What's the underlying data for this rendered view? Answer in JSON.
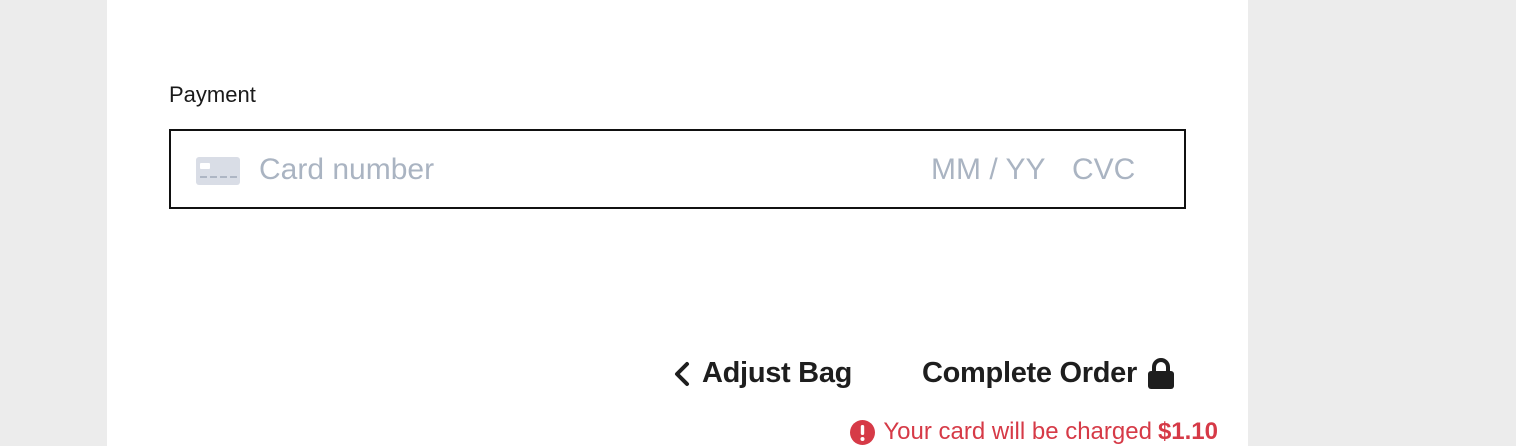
{
  "payment": {
    "label": "Payment",
    "card_number_placeholder": "Card number",
    "expiry_placeholder": "MM / YY",
    "cvc_placeholder": "CVC"
  },
  "actions": {
    "adjust_bag_label": "Adjust Bag",
    "complete_order_label": "Complete Order"
  },
  "charge_notice": {
    "text": "Your card will be charged",
    "amount": "$1.10",
    "color": "#d63a47"
  },
  "icons": {
    "card": "credit-card-icon",
    "back": "chevron-left-icon",
    "lock": "lock-icon",
    "alert": "exclamation-circle-icon"
  }
}
